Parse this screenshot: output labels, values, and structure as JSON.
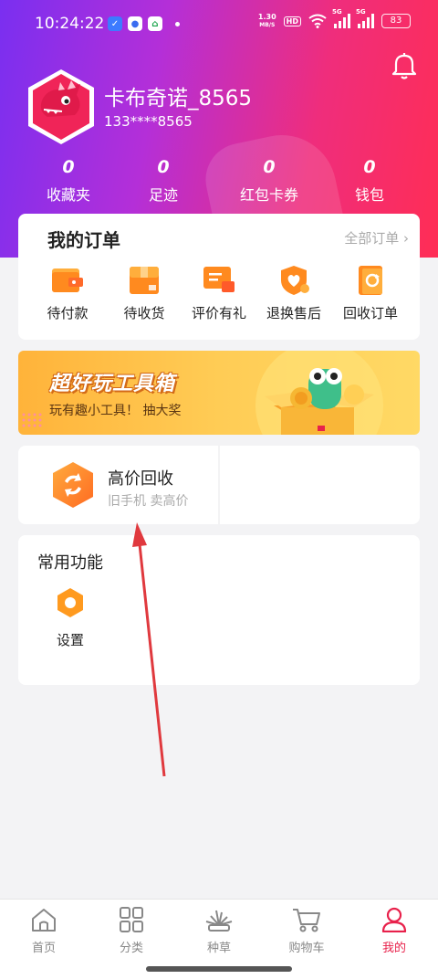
{
  "status_bar": {
    "time": "10:24:22",
    "net_speed_value": "1.30",
    "net_speed_unit": "MB/S",
    "hd_label": "HD",
    "signal_label_1": "5G",
    "signal_label_2": "5G",
    "battery": "83"
  },
  "profile": {
    "username": "卡布奇诺_8565",
    "phone": "133****8565",
    "bell_icon": "bell-icon"
  },
  "stats": [
    {
      "value": "0",
      "label": "收藏夹"
    },
    {
      "value": "0",
      "label": "足迹"
    },
    {
      "value": "0",
      "label": "红包卡券"
    },
    {
      "value": "0",
      "label": "钱包"
    }
  ],
  "orders": {
    "title": "我的订单",
    "all_link": "全部订单",
    "items": [
      {
        "label": "待付款",
        "icon": "wallet-icon"
      },
      {
        "label": "待收货",
        "icon": "package-icon"
      },
      {
        "label": "评价有礼",
        "icon": "comment-icon"
      },
      {
        "label": "退换售后",
        "icon": "shield-heart-icon"
      },
      {
        "label": "回收订单",
        "icon": "recycle-order-icon"
      }
    ]
  },
  "banner": {
    "title": "超好玩工具箱",
    "subtitle": "玩有趣小工具！ 抽大奖"
  },
  "recycle": {
    "title": "高价回收",
    "subtitle": "旧手机 卖高价"
  },
  "functions": {
    "title": "常用功能",
    "items": [
      {
        "label": "设置",
        "icon": "settings-icon"
      }
    ]
  },
  "tabs": [
    {
      "label": "首页",
      "icon": "home-icon",
      "active": false
    },
    {
      "label": "分类",
      "icon": "category-icon",
      "active": false
    },
    {
      "label": "种草",
      "icon": "grass-icon",
      "active": false
    },
    {
      "label": "购物车",
      "icon": "cart-icon",
      "active": false
    },
    {
      "label": "我的",
      "icon": "profile-icon",
      "active": true
    }
  ],
  "colors": {
    "accent": "#e8214b",
    "header_start": "#7a2ff0",
    "header_end": "#ff2d55",
    "order_icon": "#ff8a1f"
  }
}
